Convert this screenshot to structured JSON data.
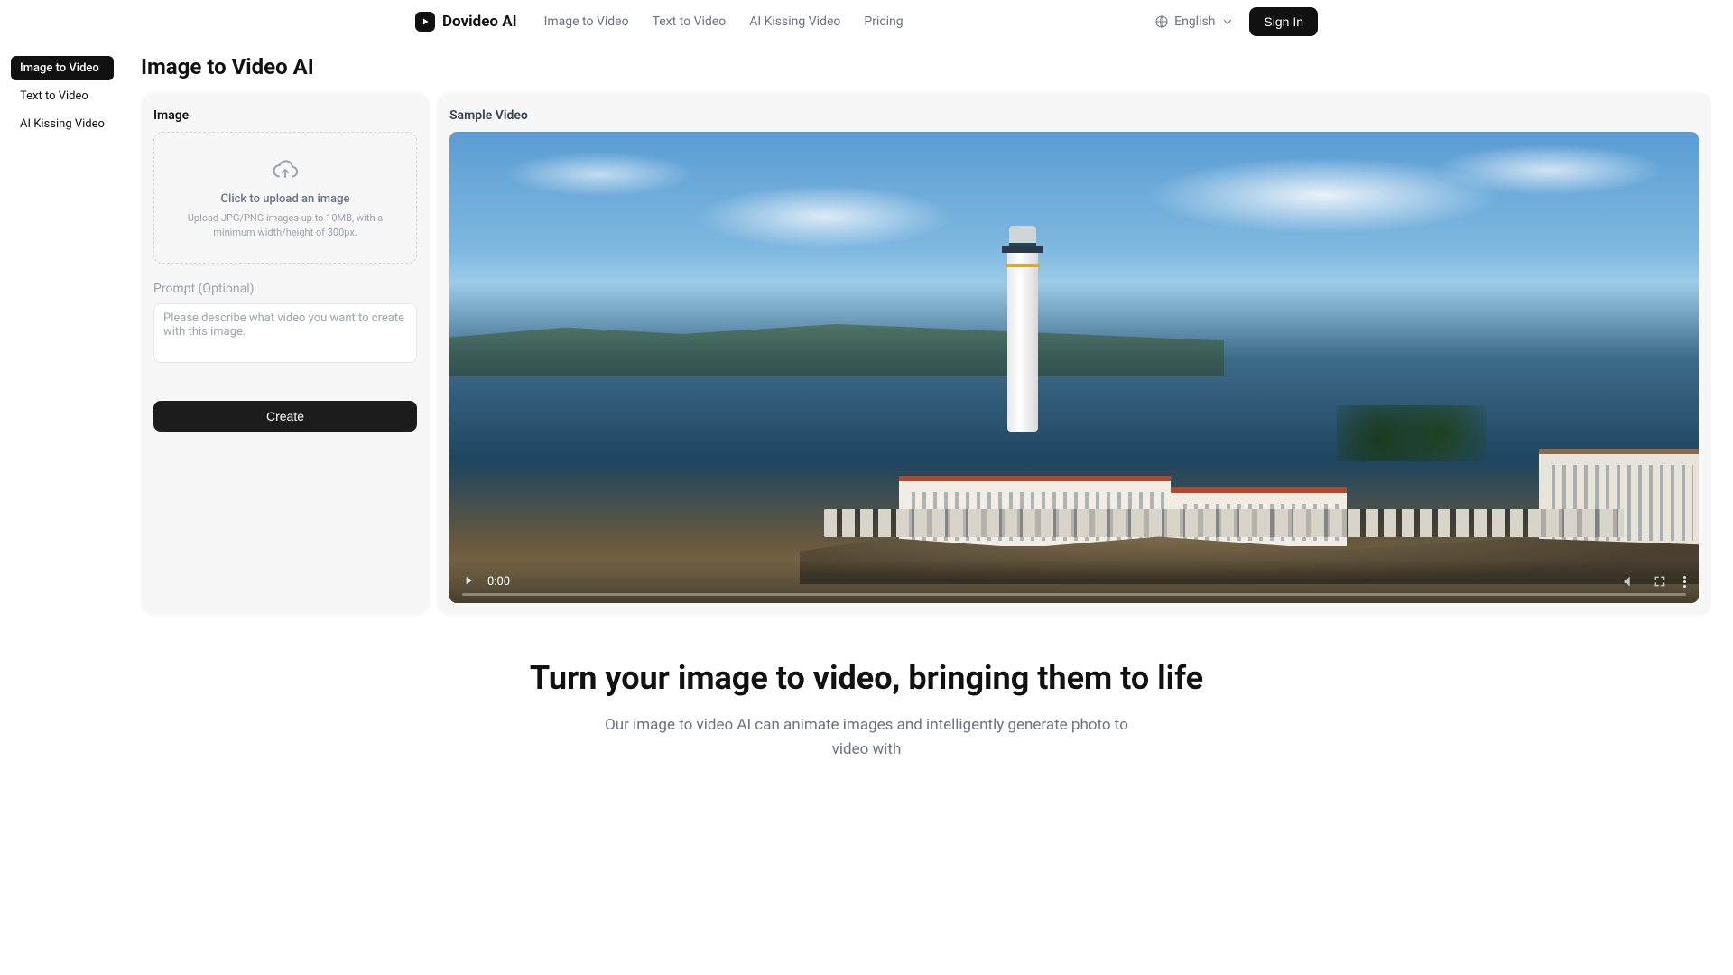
{
  "header": {
    "brand": "Dovideo AI",
    "nav": [
      "Image to Video",
      "Text to Video",
      "AI Kissing Video",
      "Pricing"
    ],
    "language": "English",
    "signin": "Sign In"
  },
  "side_tabs": [
    "Image to Video",
    "Text to Video",
    "AI Kissing Video"
  ],
  "page_title": "Image to Video AI",
  "left_panel": {
    "image_label": "Image",
    "upload_title": "Click to upload an image",
    "upload_sub": "Upload JPG/PNG images up to 10MB, with a minimum width/height of 300px.",
    "prompt_label": "Prompt",
    "prompt_optional": "(Optional)",
    "prompt_placeholder": "Please describe what video you want to create with this image.",
    "create_button": "Create"
  },
  "right_panel": {
    "sample_label": "Sample Video",
    "time": "0:00"
  },
  "hero": {
    "title": "Turn your image to video, bringing them to life",
    "subtitle": "Our image to video AI can animate images and intelligently generate photo to video with"
  }
}
